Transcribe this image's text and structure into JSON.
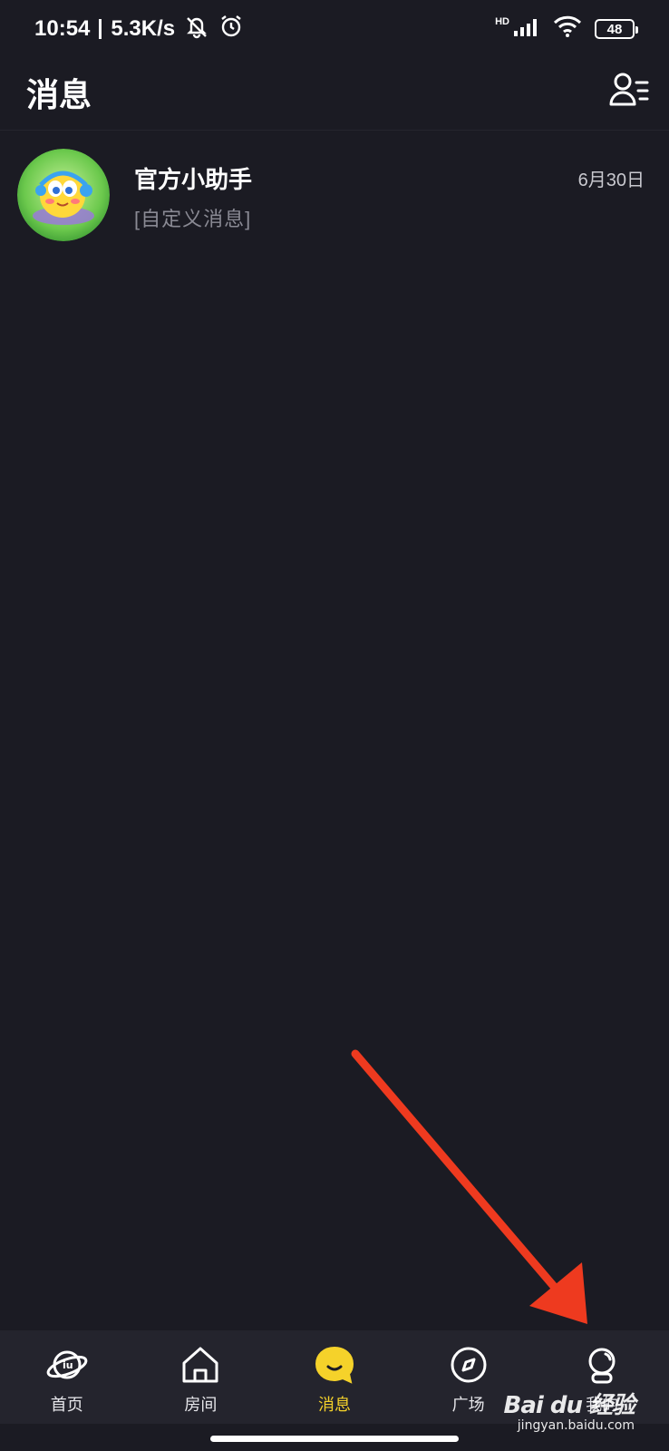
{
  "status_bar": {
    "time": "10:54",
    "net_speed": "5.3K/s",
    "hd": "HD",
    "battery": "48"
  },
  "header": {
    "title": "消息",
    "contacts_icon": "contacts-list-icon"
  },
  "messages": [
    {
      "name": "官方小助手",
      "preview": "[自定义消息]",
      "date": "6月30日",
      "avatar_icon": "assistant-mascot-avatar"
    }
  ],
  "bottom_nav": {
    "items": [
      {
        "label": "首页",
        "icon": "planet-icon",
        "active": false
      },
      {
        "label": "房间",
        "icon": "house-icon",
        "active": false
      },
      {
        "label": "消息",
        "icon": "message-bubble-icon",
        "active": true
      },
      {
        "label": "广场",
        "icon": "compass-icon",
        "active": false
      },
      {
        "label": "我的",
        "icon": "profile-icon",
        "active": false
      }
    ]
  },
  "colors": {
    "background": "#1b1b23",
    "nav_background": "#24242d",
    "accent": "#f5d22a",
    "annotation_arrow": "#ee3a1f"
  },
  "watermark": {
    "logo": "Bai du 经验",
    "url": "jingyan.baidu.com"
  }
}
